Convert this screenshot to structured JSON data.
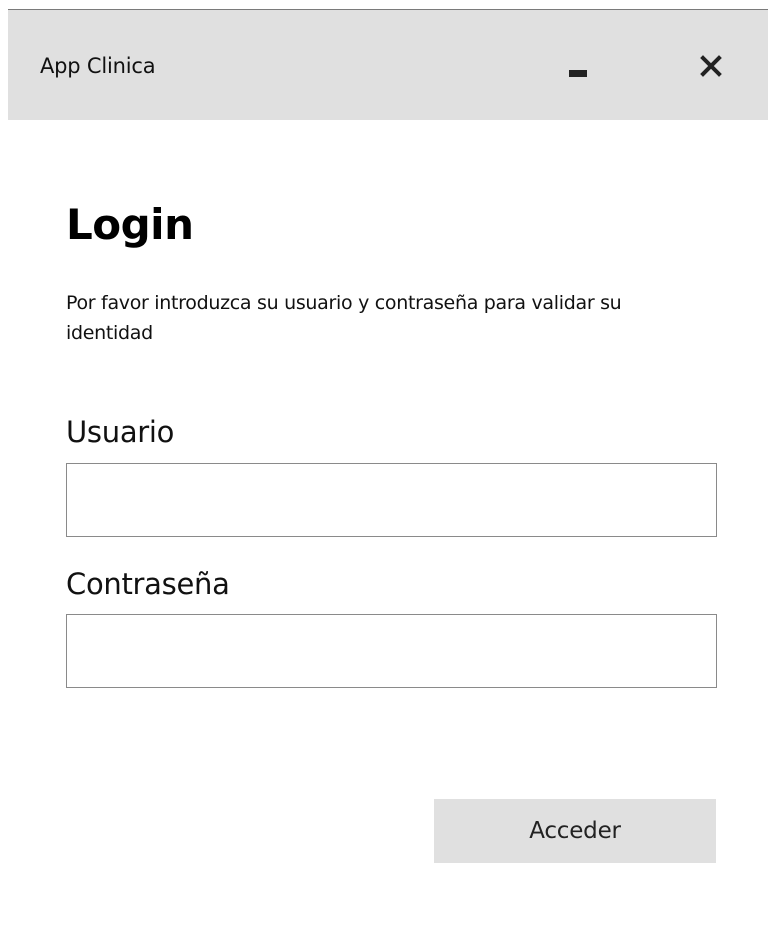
{
  "window": {
    "title": "App Clinica",
    "controls": {
      "minimize_icon": "minimize-icon",
      "close_icon": "close-icon"
    }
  },
  "login": {
    "heading": "Login",
    "instructions": "Por favor introduzca su usuario y contraseña para validar su identidad",
    "username": {
      "label": "Usuario",
      "value": "",
      "placeholder": ""
    },
    "password": {
      "label": "Contraseña",
      "value": "",
      "placeholder": ""
    },
    "submit_label": "Acceder"
  },
  "colors": {
    "titlebar_background": "#e0e0e0",
    "button_background": "#e0e0e0",
    "input_border": "#8a8a8a",
    "text": "#111111"
  }
}
